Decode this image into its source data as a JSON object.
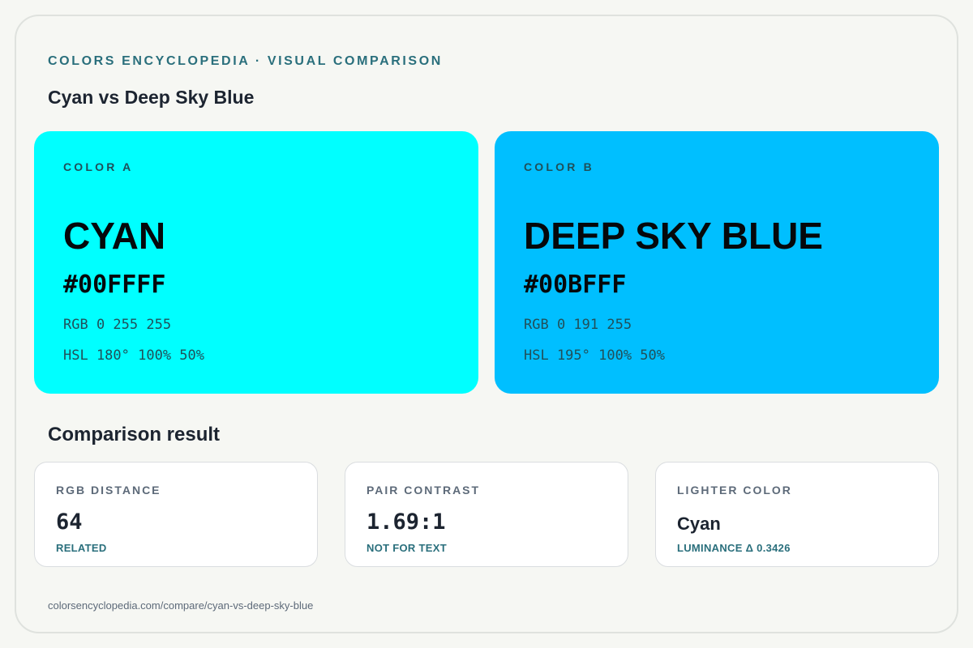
{
  "header": {
    "eyebrow": "COLORS ENCYCLOPEDIA · VISUAL COMPARISON",
    "title": "Cyan vs Deep Sky Blue"
  },
  "colors": [
    {
      "label": "COLOR A",
      "name": "CYAN",
      "hex": "#00FFFF",
      "rgb": "RGB 0 255 255",
      "hsl": "HSL 180° 100% 50%",
      "swatch_color": "#00ffff"
    },
    {
      "label": "COLOR B",
      "name": "DEEP SKY BLUE",
      "hex": "#00BFFF",
      "rgb": "RGB 0 191 255",
      "hsl": "HSL 195° 100% 50%",
      "swatch_color": "#00bfff"
    }
  ],
  "comparison": {
    "title": "Comparison result",
    "cards": [
      {
        "label": "RGB DISTANCE",
        "value": "64",
        "note": "RELATED"
      },
      {
        "label": "PAIR CONTRAST",
        "value": "1.69:1",
        "note": "NOT FOR TEXT"
      },
      {
        "label": "LIGHTER COLOR",
        "value": "Cyan",
        "note": "LUMINANCE Δ 0.3426"
      }
    ]
  },
  "footer": {
    "url": "colorsencyclopedia.com/compare/cyan-vs-deep-sky-blue"
  },
  "theme": {
    "accent": "#2a6f7c",
    "background": "#f6f7f3"
  }
}
